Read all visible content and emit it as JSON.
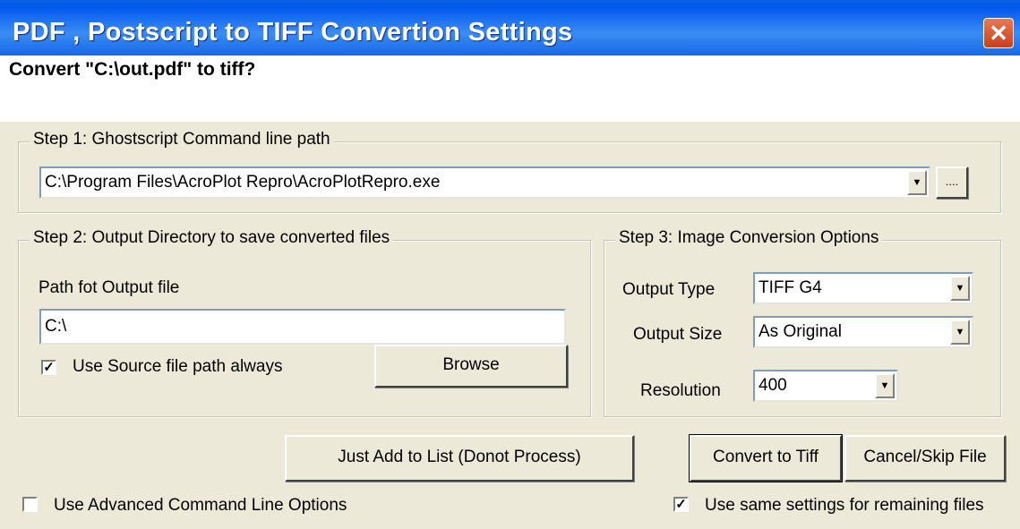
{
  "window": {
    "title": "PDF , Postscript to TIFF Convertion Settings",
    "close_glyph": "✕"
  },
  "prompt": "Convert \"C:\\out.pdf\" to tiff?",
  "step1": {
    "legend": "Step 1: Ghostscript Command line path",
    "path_value": "C:\\Program Files\\AcroPlot Repro\\AcroPlotRepro.exe",
    "browse_label": "...."
  },
  "step2": {
    "legend": "Step 2: Output Directory to save converted files",
    "path_label": "Path fot Output file",
    "path_value": "C:\\",
    "use_source_label": "Use Source file path always",
    "use_source_checked": true,
    "browse_label": "Browse"
  },
  "step3": {
    "legend": "Step 3: Image Conversion Options",
    "output_type_label": "Output Type",
    "output_type_value": "TIFF G4",
    "output_size_label": "Output Size",
    "output_size_value": "As Original",
    "resolution_label": "Resolution",
    "resolution_value": "400"
  },
  "actions": {
    "add_to_list": "Just Add to List (Donot Process)",
    "convert": "Convert to Tiff",
    "cancel": "Cancel/Skip File"
  },
  "options": {
    "advanced_label": "Use Advanced Command Line Options",
    "advanced_checked": false,
    "same_settings_label": "Use same settings for remaining files",
    "same_settings_checked": true
  },
  "icons": {
    "dropdown": "dropdown-arrow-icon",
    "checkmark": "checkmark-icon",
    "close": "close-icon"
  },
  "colors": {
    "titlebar": "#0a5ee0",
    "close": "#d9522a",
    "dialog_bg": "#ece9d8"
  }
}
